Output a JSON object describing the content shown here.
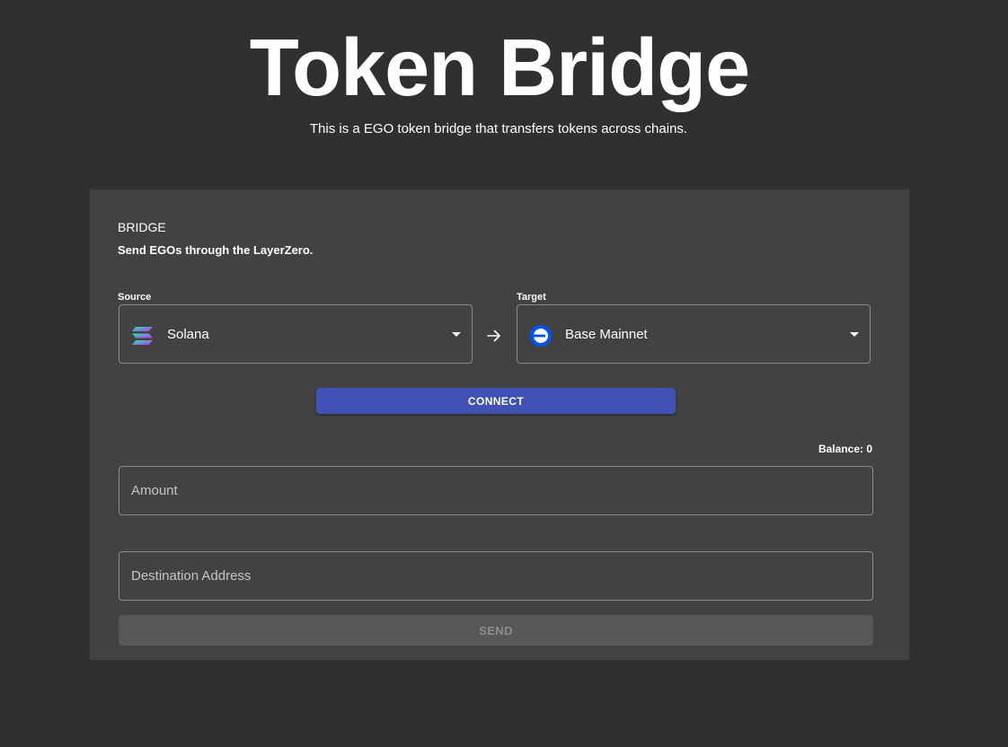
{
  "header": {
    "title": "Token Bridge",
    "subtitle": "This is a EGO token bridge that transfers tokens across chains."
  },
  "card": {
    "title": "BRIDGE",
    "subtitle": "Send EGOs through the LayerZero."
  },
  "source": {
    "label": "Source",
    "value": "Solana",
    "icon": "solana-icon"
  },
  "target": {
    "label": "Target",
    "value": "Base Mainnet",
    "icon": "base-icon"
  },
  "connect_label": "CONNECT",
  "balance_text": "Balance: 0",
  "amount": {
    "placeholder": "Amount",
    "value": ""
  },
  "destination": {
    "placeholder": "Destination Address",
    "value": ""
  },
  "send_label": "SEND",
  "colors": {
    "background": "#303030",
    "card": "#424242",
    "accent": "#3f51b5",
    "disabled": "#575757",
    "base_blue": "#0052ff"
  }
}
